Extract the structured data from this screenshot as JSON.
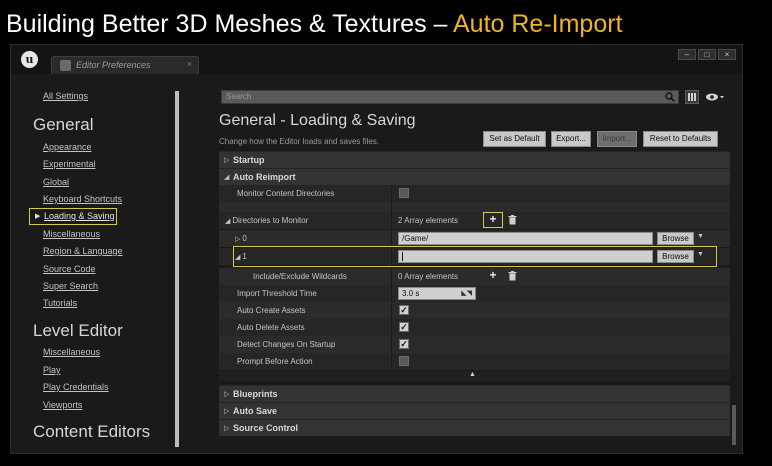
{
  "slide": {
    "title_main": "Building Better 3D Meshes & Textures – ",
    "title_accent": "Auto Re-Import"
  },
  "window": {
    "logo": "u",
    "tab_label": "Editor Preferences",
    "tab_close": "×",
    "minimize": "–",
    "maximize": "□",
    "close": "×"
  },
  "sidebar": {
    "all_settings": "All Settings",
    "general_title": "General",
    "general_items": [
      "Appearance",
      "Experimental",
      "Global",
      "Keyboard Shortcuts",
      "Loading & Saving",
      "Miscellaneous",
      "Region & Language",
      "Source Code",
      "Super Search",
      "Tutorials"
    ],
    "selected_item": "Loading & Saving",
    "level_editor_title": "Level Editor",
    "level_editor_items": [
      "Miscellaneous",
      "Play",
      "Play Credentials",
      "Viewports"
    ],
    "content_editors_title": "Content Editors"
  },
  "search": {
    "placeholder": "Search"
  },
  "main": {
    "title": "General - Loading & Saving",
    "subtitle": "Change how the Editor loads and saves files.",
    "buttons": {
      "set_default": "Set as Default",
      "export": "Export...",
      "import": "Import...",
      "reset": "Reset to Defaults"
    }
  },
  "panel": {
    "startup": "Startup",
    "auto_reimport": "Auto Reimport",
    "monitor_content": "Monitor Content Directories",
    "directories": "Directories to Monitor",
    "directories_count": "2 Array elements",
    "index0": "0",
    "index0_path": "/Game/",
    "index1": "1",
    "index1_path": "",
    "browse": "Browse",
    "wildcards": "Include/Exclude Wildcards",
    "wildcards_count": "0 Array elements",
    "threshold": "Import Threshold Time",
    "threshold_value": "3.0 s",
    "auto_create": "Auto Create Assets",
    "auto_delete": "Auto Delete Assets",
    "detect_changes": "Detect Changes On Startup",
    "prompt": "Prompt Before Action",
    "blueprints": "Blueprints",
    "auto_save": "Auto Save",
    "source_control": "Source Control"
  },
  "checkboxes": {
    "monitor_content": false,
    "auto_create": true,
    "auto_delete": true,
    "detect_changes": true,
    "prompt": false
  },
  "colors": {
    "accent": "#f0b323",
    "highlight": "#d5c94a"
  }
}
